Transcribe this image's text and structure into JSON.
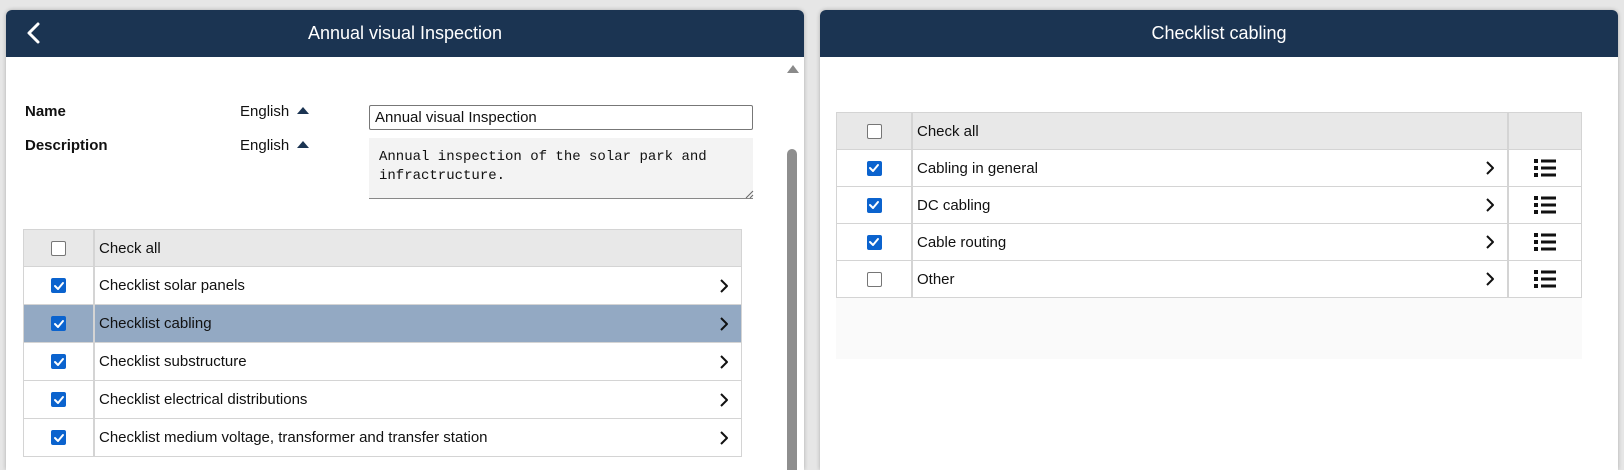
{
  "left_panel": {
    "title": "Annual visual Inspection",
    "form": {
      "name_label": "Name",
      "name_lang": "English",
      "name_value": "Annual visual Inspection",
      "description_label": "Description",
      "description_lang": "English",
      "description_value": "Annual inspection of the solar park and infractructure."
    },
    "checklists": {
      "check_all_label": "Check all",
      "check_all_checked": false,
      "items": [
        {
          "label": "Checklist solar panels",
          "checked": true,
          "selected": false
        },
        {
          "label": "Checklist cabling",
          "checked": true,
          "selected": true
        },
        {
          "label": "Checklist substructure",
          "checked": true,
          "selected": false
        },
        {
          "label": "Checklist electrical distributions",
          "checked": true,
          "selected": false
        },
        {
          "label": "Checklist medium voltage, transformer and transfer station",
          "checked": true,
          "selected": false
        }
      ]
    }
  },
  "right_panel": {
    "title": "Checklist cabling",
    "check_all_label": "Check all",
    "check_all_checked": false,
    "items": [
      {
        "label": "Cabling in general",
        "checked": true
      },
      {
        "label": "DC cabling",
        "checked": true
      },
      {
        "label": "Cable routing",
        "checked": true
      },
      {
        "label": "Other",
        "checked": false
      }
    ]
  },
  "colors": {
    "header_bg": "#1b3452",
    "selected_row": "#93a9c3",
    "checkbox_on": "#0b63ce"
  },
  "icons": [
    "back-arrow-icon",
    "sort-up-icon",
    "chevron-right-icon",
    "list-icon",
    "checkmark-icon"
  ]
}
